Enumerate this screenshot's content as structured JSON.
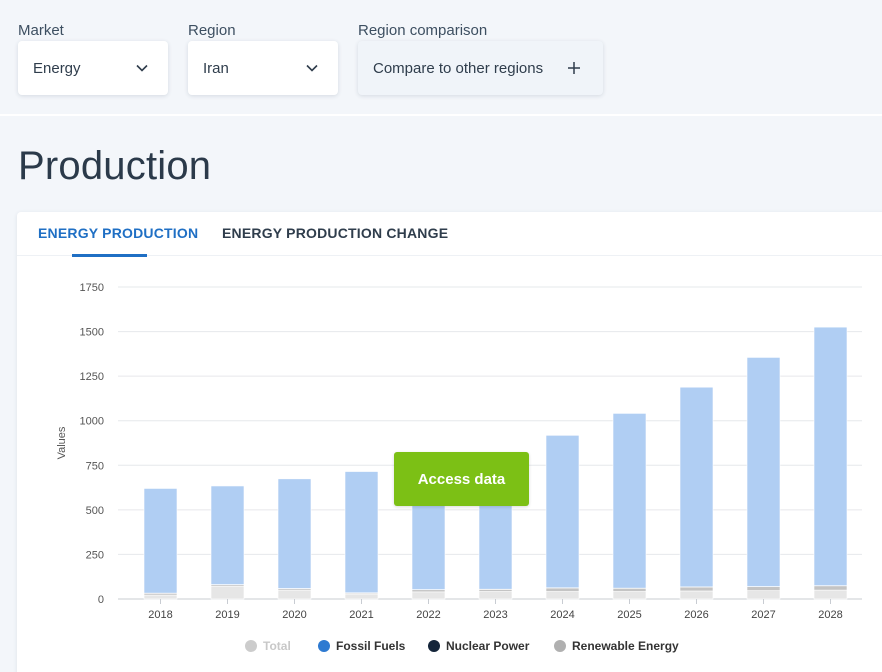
{
  "filters": {
    "market": {
      "label": "Market",
      "value": "Energy"
    },
    "region": {
      "label": "Region",
      "value": "Iran"
    },
    "comparison": {
      "label": "Region comparison",
      "value": "Compare to other regions"
    }
  },
  "page": {
    "title": "Production"
  },
  "tabs": [
    {
      "label": "ENERGY PRODUCTION",
      "active": true
    },
    {
      "label": "ENERGY PRODUCTION CHANGE",
      "active": false
    }
  ],
  "access_button": "Access data",
  "legend": [
    {
      "name": "Total",
      "color": "#cccccc",
      "disabled": true
    },
    {
      "name": "Fossil Fuels",
      "color": "#2e7ad1",
      "disabled": false
    },
    {
      "name": "Nuclear Power",
      "color": "#14253a",
      "disabled": false
    },
    {
      "name": "Renewable Energy",
      "color": "#b0b0b0",
      "disabled": false
    }
  ],
  "chart_data": {
    "type": "bar",
    "ylabel": "Values",
    "ylim": [
      0,
      1750
    ],
    "yticks": [
      0,
      250,
      500,
      750,
      1000,
      1250,
      1500,
      1750
    ],
    "categories": [
      "2018",
      "2019",
      "2020",
      "2021",
      "2022",
      "2023",
      "2024",
      "2025",
      "2026",
      "2027",
      "2028"
    ],
    "series": [
      {
        "name": "Fossil Fuels",
        "color": "#b0cef3",
        "values": [
          587,
          553,
          615,
          680,
          535,
          540,
          855,
          980,
          1120,
          1285,
          1450
        ]
      },
      {
        "name": "Nuclear Power",
        "color": "#14253a",
        "values": [
          1,
          1,
          1,
          1,
          1,
          1,
          1,
          1,
          1,
          1,
          1
        ]
      },
      {
        "name": "Renewable Energy",
        "color": "#c4c4c4",
        "values": [
          10,
          8,
          8,
          6,
          12,
          12,
          20,
          18,
          22,
          22,
          24
        ]
      },
      {
        "name": "Total",
        "color": "#e6e6e6",
        "values": [
          22,
          72,
          50,
          28,
          40,
          42,
          42,
          42,
          45,
          47,
          50
        ]
      }
    ],
    "grid": true,
    "legend_position": "bottom"
  }
}
